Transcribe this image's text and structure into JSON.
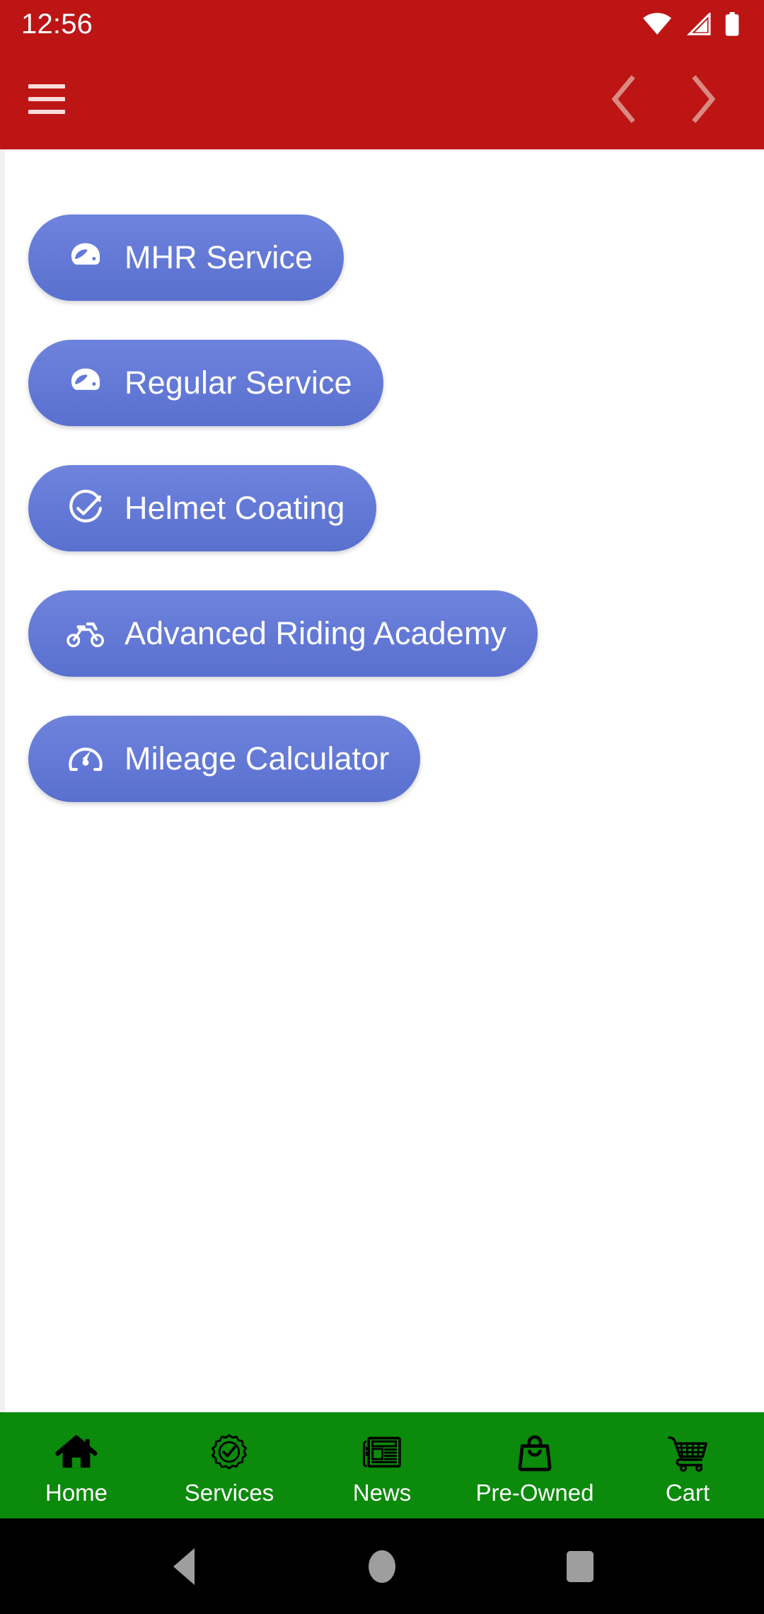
{
  "colors": {
    "app_bar_red": "#bd1414",
    "pill_blue": "#6179d8",
    "bottom_nav_green": "#0b8a0b",
    "system_bar_black": "#000000",
    "nav_arrow_disabled": "#d98a82"
  },
  "status_bar": {
    "clock": "12:56",
    "icons": [
      "wifi-icon",
      "cellular-signal-icon",
      "battery-icon"
    ]
  },
  "app_bar": {
    "menu_icon": "hamburger-menu-icon",
    "back_icon": "chevron-left-icon",
    "forward_icon": "chevron-right-icon"
  },
  "main": {
    "buttons": [
      {
        "label": "MHR Service",
        "icon": "helmet-icon"
      },
      {
        "label": "Regular Service",
        "icon": "helmet-icon"
      },
      {
        "label": "Helmet Coating",
        "icon": "check-circle-icon"
      },
      {
        "label": "Advanced Riding Academy",
        "icon": "motorcycle-icon"
      },
      {
        "label": "Mileage Calculator",
        "icon": "speedometer-icon"
      }
    ]
  },
  "bottom_nav": {
    "items": [
      {
        "label": "Home",
        "icon": "home-icon"
      },
      {
        "label": "Services",
        "icon": "badge-check-icon"
      },
      {
        "label": "News",
        "icon": "newspaper-icon"
      },
      {
        "label": "Pre-Owned",
        "icon": "shopping-bag-icon"
      },
      {
        "label": "Cart",
        "icon": "shopping-cart-icon"
      }
    ]
  },
  "system_bar": {
    "back_label": "back-button",
    "home_label": "home-button",
    "recents_label": "recents-button"
  }
}
